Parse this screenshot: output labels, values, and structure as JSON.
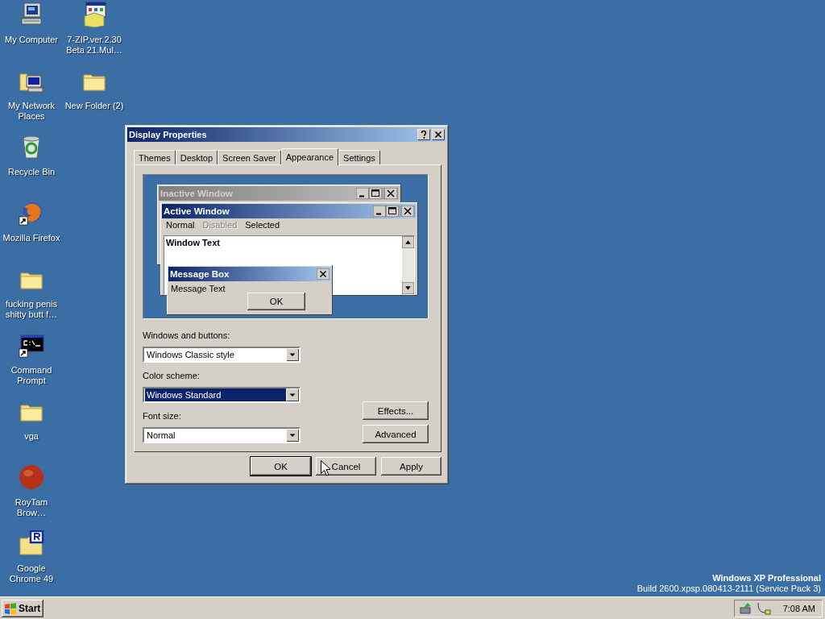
{
  "desktop_icons": [
    {
      "label": "My Computer",
      "kind": "computer",
      "shortcut": false
    },
    {
      "label": "7-ZIP.ver.2.30 Beta 21.Mul…",
      "kind": "installer",
      "shortcut": false
    },
    {
      "label": "My Network Places",
      "kind": "network",
      "shortcut": false
    },
    {
      "label": "New Folder (2)",
      "kind": "folder",
      "shortcut": false
    },
    {
      "label": "Recycle Bin",
      "kind": "recycle",
      "shortcut": false
    },
    {
      "label": "Mozilla Firefox",
      "kind": "browser",
      "shortcut": true
    },
    {
      "label": "fucking penis shitty butt f…",
      "kind": "folder",
      "shortcut": false
    },
    {
      "label": "Command Prompt",
      "kind": "console",
      "shortcut": true
    },
    {
      "label": "vga",
      "kind": "folder",
      "shortcut": false
    },
    {
      "label": "RoyTam Brow…",
      "kind": "sphere",
      "shortcut": false
    },
    {
      "label": "Google Chrome 49",
      "kind": "tagged_folder",
      "shortcut": false
    }
  ],
  "dialog": {
    "title": "Display Properties",
    "tabs": [
      {
        "label": "Themes",
        "selected": false
      },
      {
        "label": "Desktop",
        "selected": false
      },
      {
        "label": "Screen Saver",
        "selected": false
      },
      {
        "label": "Appearance",
        "selected": true
      },
      {
        "label": "Settings",
        "selected": false
      }
    ],
    "preview": {
      "inactive_title": "Inactive Window",
      "active_title": "Active Window",
      "menu": [
        {
          "label": "Normal",
          "disabled": false
        },
        {
          "label": "Disabled",
          "disabled": true
        },
        {
          "label": "Selected",
          "disabled": false
        }
      ],
      "window_text": "Window Text",
      "message_box_title": "Message Box",
      "message_text": "Message Text",
      "ok": "OK"
    },
    "fields": [
      {
        "label": "Windows and buttons:",
        "value": "Windows Classic style",
        "focused": false
      },
      {
        "label": "Color scheme:",
        "value": "Windows Standard",
        "focused": true
      },
      {
        "label": "Font size:",
        "value": "Normal",
        "focused": false
      }
    ],
    "side_buttons": [
      "Effects...",
      "Advanced"
    ],
    "buttons": [
      {
        "label": "OK",
        "default": true
      },
      {
        "label": "Cancel",
        "default": false
      },
      {
        "label": "Apply",
        "default": false
      }
    ]
  },
  "watermark": {
    "edition": "Windows XP Professional",
    "build": "Build 2600.xpsp.080413-2111 (Service Pack 3)"
  },
  "taskbar": {
    "start": "Start",
    "clock": "7:08 AM"
  }
}
